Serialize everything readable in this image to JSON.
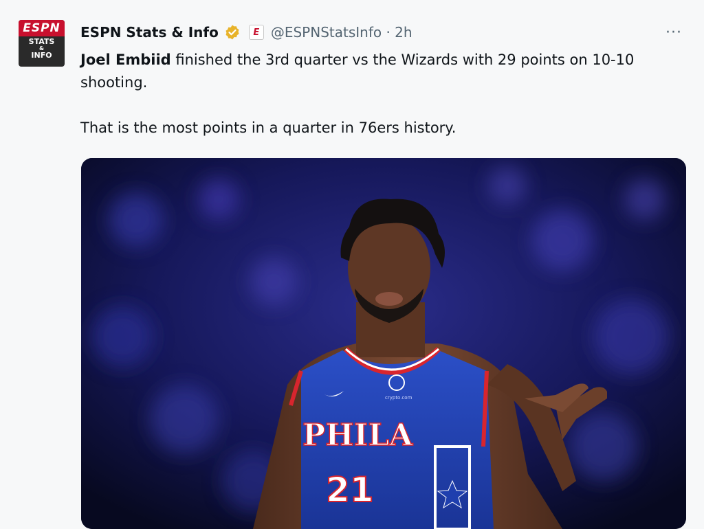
{
  "account": {
    "avatar_top": "ESPN",
    "avatar_lines": [
      "STATS",
      "&",
      "INFO"
    ],
    "name": "ESPN Stats & Info",
    "handle_time": "@ESPNStatsInfo · 2h",
    "more": "···"
  },
  "tweet": {
    "mention": "Joel Embiid",
    "text_rest": " finished the 3rd quarter vs the Wizards with 29 points on 10-10 shooting.",
    "line2": "That is the most points in a quarter in 76ers history."
  },
  "photo": {
    "jersey_text": "PHILA",
    "jersey_number": "21",
    "patch_text": "crypto.com"
  },
  "colors": {
    "verified_gold": "#e8b32a",
    "espn_red": "#c8102e",
    "jersey_blue": "#1f3fae",
    "jersey_red": "#d8252e"
  }
}
